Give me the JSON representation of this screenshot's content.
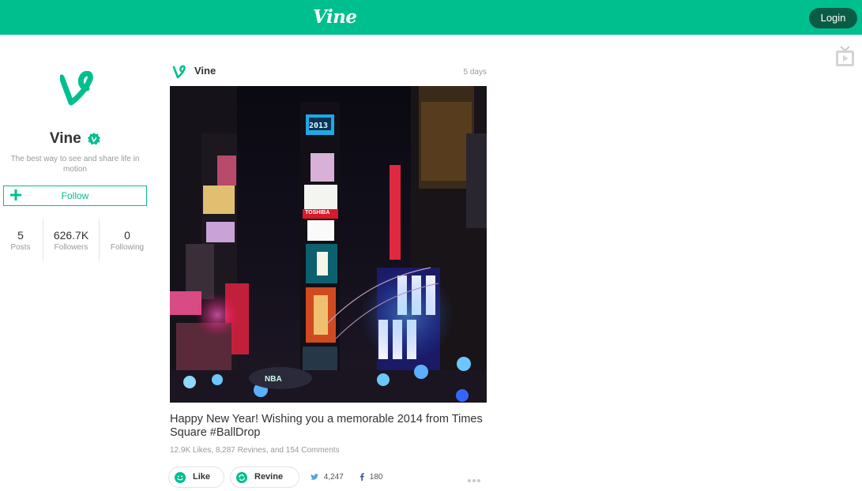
{
  "header": {
    "brand": "Vine",
    "login_label": "Login",
    "accent_color": "#00bf8f",
    "tv_icon": "tv-icon"
  },
  "profile": {
    "name": "Vine",
    "verified": true,
    "description": "The best way to see and share life in motion",
    "follow_label": "Follow",
    "stats": [
      {
        "value": "5",
        "label": "Posts"
      },
      {
        "value": "626.7K",
        "label": "Followers"
      },
      {
        "value": "0",
        "label": "Following"
      }
    ]
  },
  "post": {
    "author": "Vine",
    "time": "5 days",
    "caption": "Happy New Year! Wishing you a memorable 2014 from Times Square",
    "hashtag": "#BallDrop",
    "stats_line": "12.9K Likes, 8,287 Revines, and 154 Comments",
    "like_label": "Like",
    "revine_label": "Revine",
    "twitter_count": "4,247",
    "facebook_count": "180",
    "billboard_text": "TOSHIBA",
    "clock_text": "2013"
  }
}
